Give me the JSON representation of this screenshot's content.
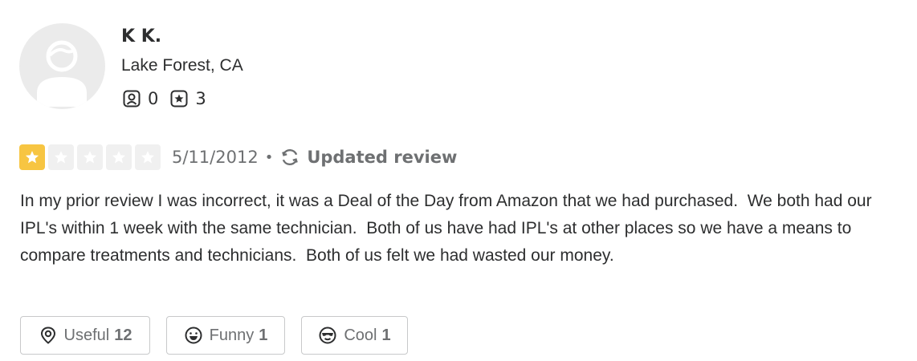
{
  "user": {
    "name": "K K.",
    "location": "Lake Forest, CA",
    "friends_count": "0",
    "reviews_count": "3"
  },
  "review": {
    "rating": 1,
    "max_rating": 5,
    "date": "5/11/2012",
    "separator": "•",
    "updated_label": "Updated review",
    "text": "In my prior review I was incorrect, it was a Deal of the Day from Amazon that we had purchased.  We both had our IPL's within 1 week with the same technician.  Both of us have had IPL's at other places so we have a means to compare treatments and technicians.  Both of us felt we had wasted our money."
  },
  "reactions": [
    {
      "label": "Useful",
      "count": "12",
      "icon": "useful-icon"
    },
    {
      "label": "Funny",
      "count": "1",
      "icon": "funny-icon"
    },
    {
      "label": "Cool",
      "count": "1",
      "icon": "cool-icon"
    }
  ],
  "colors": {
    "star_filled": "#f7c542",
    "star_empty": "#f0f0f0",
    "muted_text": "#6e7072",
    "body_text": "#2d2e2f"
  }
}
